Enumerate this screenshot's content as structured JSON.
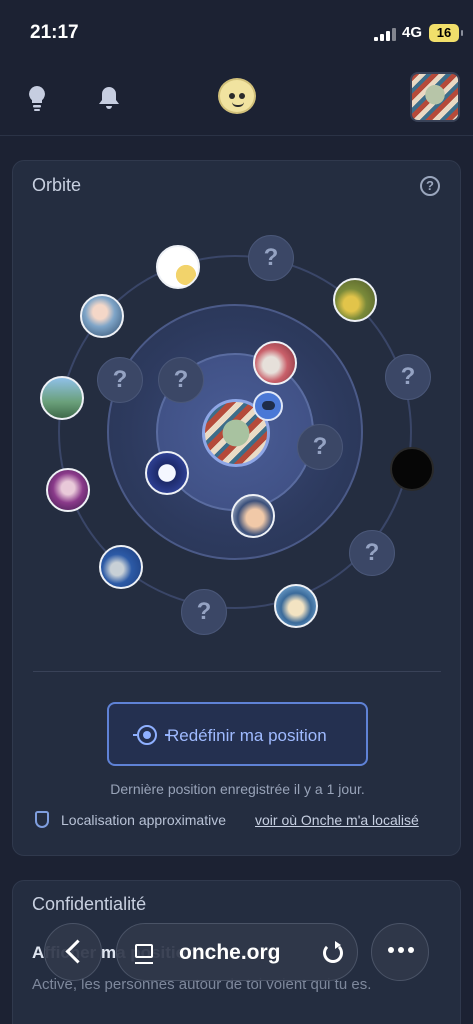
{
  "status_bar": {
    "time": "21:17",
    "network": "4G",
    "battery": "16"
  },
  "nav": {
    "icons": [
      "lightbulb-icon",
      "bell-icon",
      "onche-logo",
      "profile-avatar"
    ]
  },
  "orbit": {
    "title": "Orbite",
    "help": "?",
    "unknown_marker": "?",
    "reset_button": "Redéfinir ma position",
    "last_position": "Dernière position enregistrée il y a 1 jour.",
    "location_note": "Localisation approximative",
    "location_link": "voir où Onche m'a localisé"
  },
  "privacy": {
    "title": "Confidentialité",
    "line1": "Afficher ma position",
    "description": "Active, les personnes autour de toi voient qui tu es."
  },
  "browser": {
    "url": "onche.org"
  },
  "colors": {
    "background": "#1c2233",
    "card": "#242d40",
    "accent": "#5f82d6",
    "link": "#9fbaff"
  }
}
